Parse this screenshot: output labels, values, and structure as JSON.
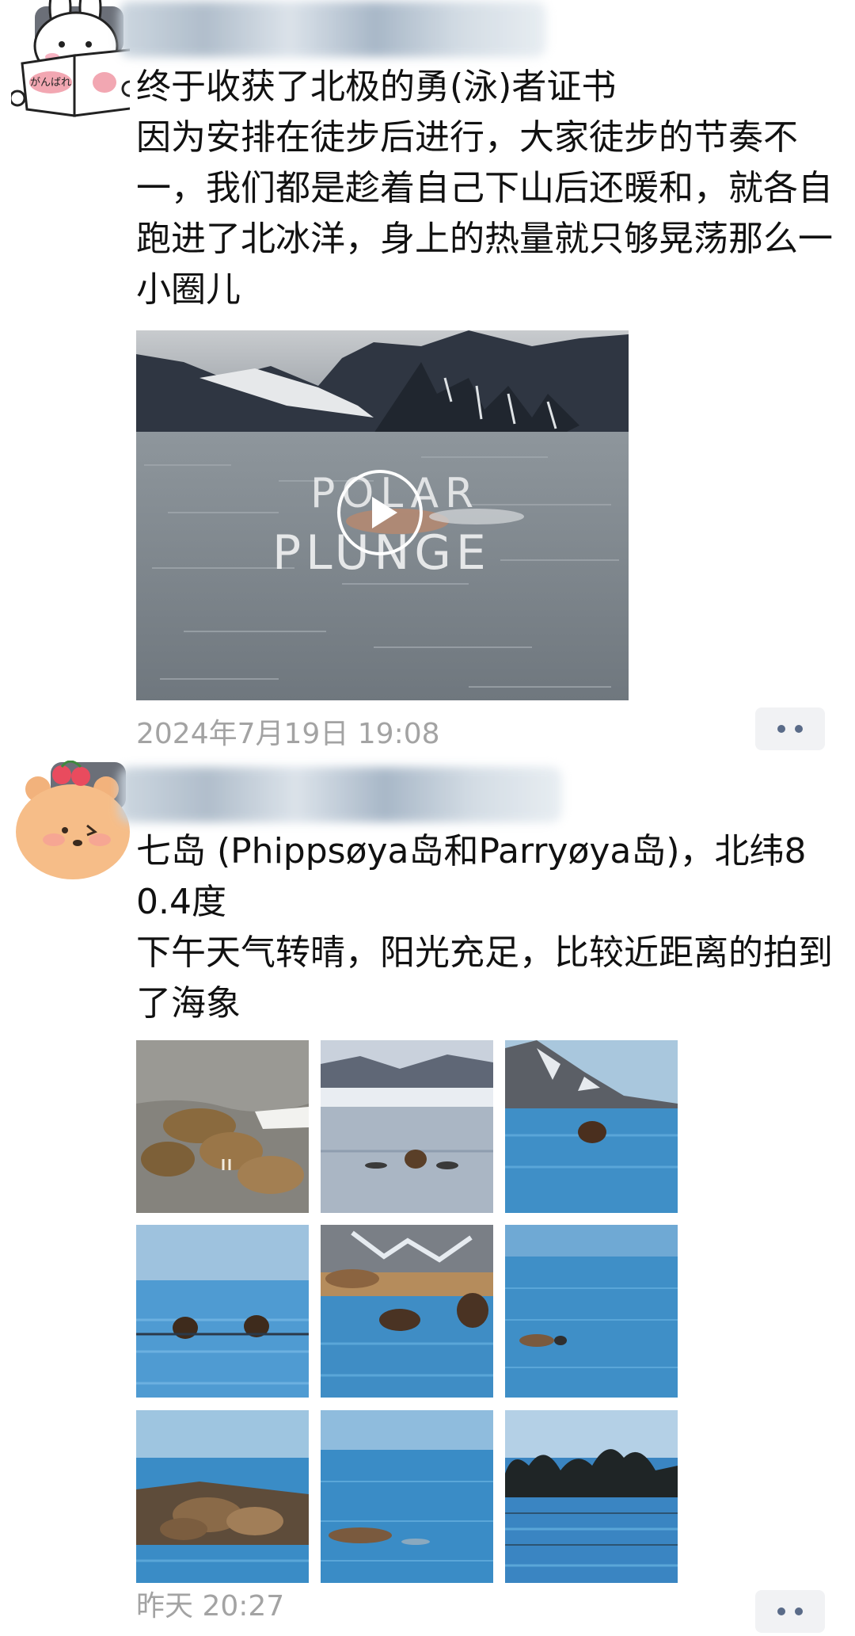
{
  "posts": [
    {
      "text": "终于收获了北极的勇(泳)者证书\n因为安排在徒步后进行，大家徒步的节奏不一，我们都是趁着自己下山后还暖和，就各自跑进了北冰洋，身上的热量就只够晃荡那么一小圈儿",
      "video_overlay_line1": "POLAR",
      "video_overlay_line2": "PLUNGE",
      "avatar_book_text": "がんばれ",
      "timestamp": "2024年7月19日 19:08"
    },
    {
      "text": "七岛 (Phippsøya岛和Parryøya岛)，北纬80.4度\n下午天气转晴，阳光充足，比较近距离的拍到了海象",
      "timestamp": "昨天 20:27",
      "photos": [
        "walrus-rocks",
        "walrus-ice",
        "walrus-fjord",
        "walrus-sea-pair",
        "walrus-shore-group",
        "walrus-calm-sea",
        "walrus-beach",
        "walrus-blue-water",
        "walrus-silhouettes"
      ]
    }
  ],
  "icons": {
    "more": "more-dots-icon",
    "play": "play-icon"
  }
}
